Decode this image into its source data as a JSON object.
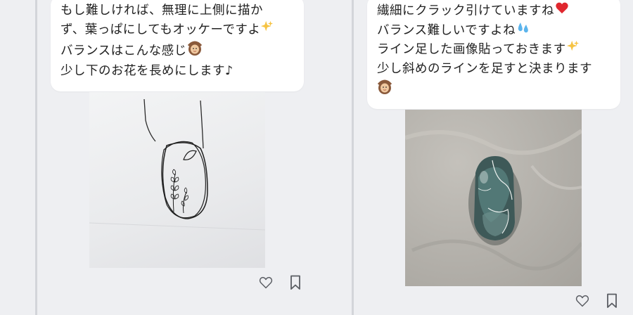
{
  "left_post": {
    "lines": [
      "もし難しければ、無理に上側に描か",
      "ず、葉っぱにしてもオッケーですよ",
      "バランスはこんな感じ",
      "少し下のお花を長めにします♪"
    ],
    "emojis": [
      "sparkles",
      "woman-gesturing-ok"
    ]
  },
  "right_post": {
    "lines": [
      "繊細にクラック引けていますね",
      "バランス難しいですよね",
      "ライン足した画像貼っておきます",
      "少し斜めのラインを足すと決まります"
    ],
    "emojis": [
      "red-heart",
      "sweat-droplets",
      "sparkles",
      "woman-gesturing-ok"
    ]
  },
  "icons": [
    "heart-outline-icon",
    "bookmark-outline-icon"
  ]
}
